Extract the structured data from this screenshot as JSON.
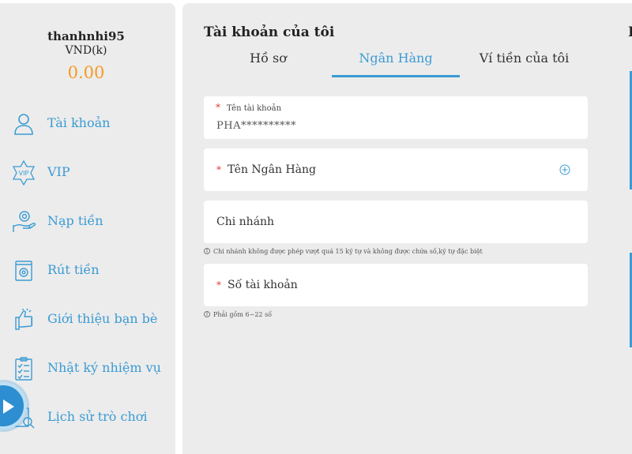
{
  "user": {
    "name": "thanhnhi95",
    "currency": "VND(k)",
    "balance": "0.00"
  },
  "sidebar": {
    "items": [
      {
        "label": "Tài khoản",
        "icon": "user-icon"
      },
      {
        "label": "VIP",
        "icon": "vip-badge-icon"
      },
      {
        "label": "Nạp tiền",
        "icon": "deposit-icon"
      },
      {
        "label": "Rút tiền",
        "icon": "withdraw-icon"
      },
      {
        "label": "Giới thiệu bạn bè",
        "icon": "refer-friend-icon"
      },
      {
        "label": "Nhật ký nhiệm vụ",
        "icon": "task-log-icon"
      },
      {
        "label": "Lịch sử trò chơi",
        "icon": "game-history-icon"
      }
    ]
  },
  "main": {
    "title": "Tài khoản của tôi",
    "right_cut_letter": "I",
    "tabs": [
      {
        "label": "Hồ sơ",
        "active": false
      },
      {
        "label": "Ngân Hàng",
        "active": true
      },
      {
        "label": "Ví tiền của tôi",
        "active": false
      }
    ],
    "form": {
      "account_name": {
        "required_mark": "*",
        "label": "Tên tài khoản",
        "value": "PHA**********"
      },
      "bank_name": {
        "required_mark": "*",
        "label": "Tên Ngân Hàng"
      },
      "branch": {
        "label": "Chi nhánh",
        "hint": "Chi nhánh không được phép vượt quá 15 ký tự và không được chứa số,ký tự đặc biệt"
      },
      "account_number": {
        "required_mark": "*",
        "label": "Số tài khoản",
        "hint": "Phải gồm 6~22 số"
      }
    }
  },
  "colors": {
    "accent": "#3b9bd4",
    "balance": "#f59a23",
    "required": "#e0403b",
    "panel_bg": "#ececec"
  }
}
